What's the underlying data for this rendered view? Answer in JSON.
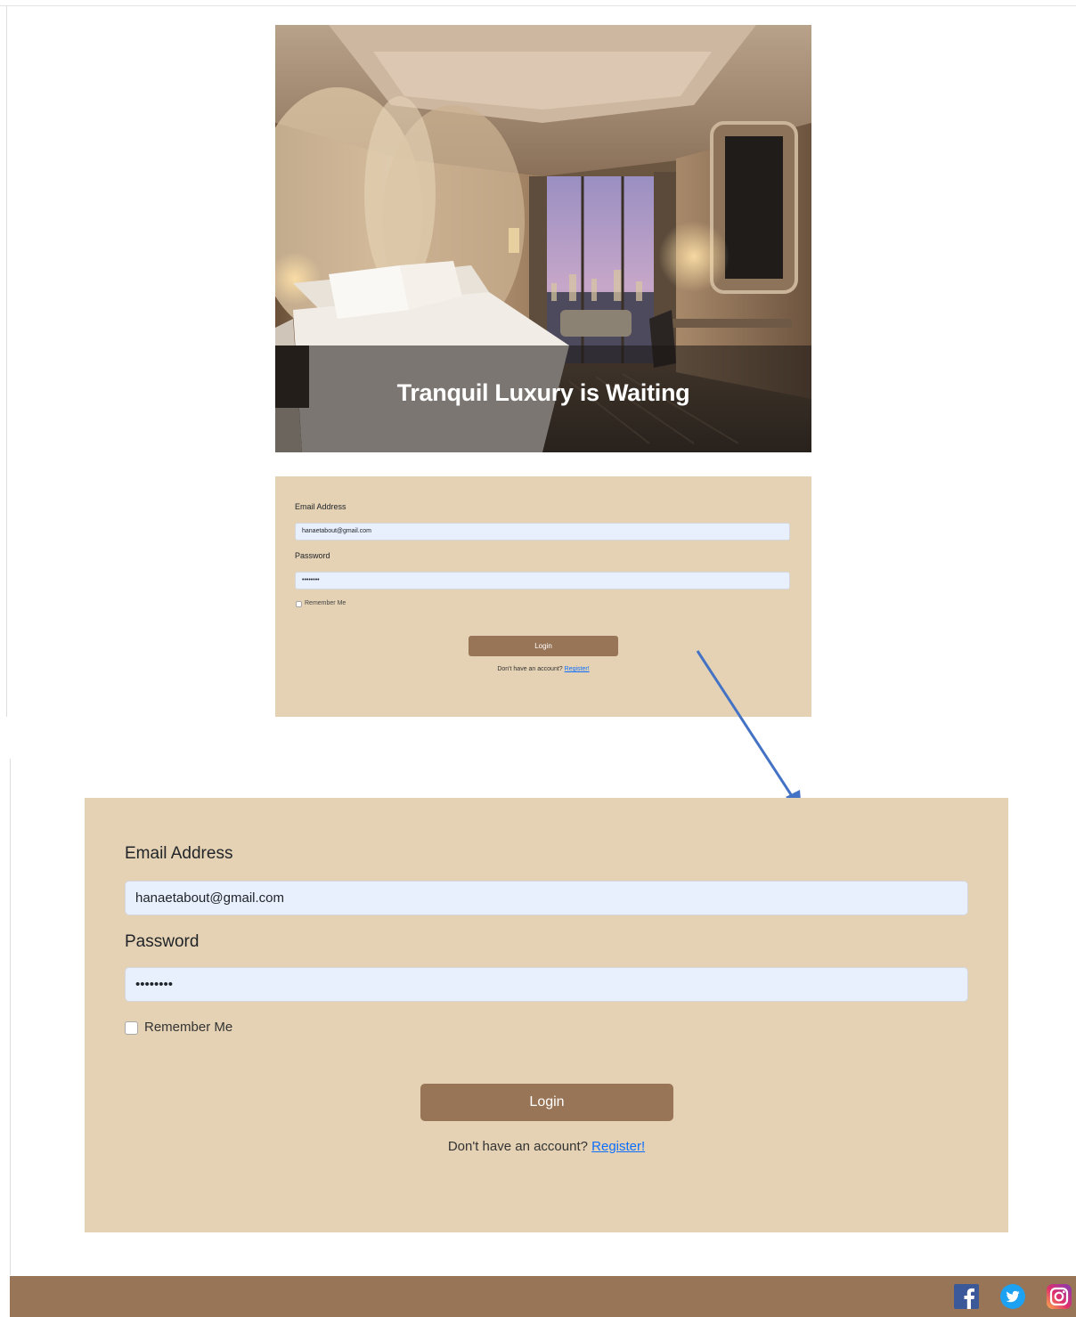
{
  "hero": {
    "title": "Tranquil Luxury is Waiting"
  },
  "login_small": {
    "email_label": "Email Address",
    "email_value": "hanaetabout@gmail.com",
    "password_label": "Password",
    "password_value": "••••••••",
    "remember_label": "Remember Me",
    "login_label": "Login",
    "register_prompt": "Don't have an account?",
    "register_link": "Register!"
  },
  "login_large": {
    "email_label": "Email Address",
    "email_value": "hanaetabout@gmail.com",
    "password_label": "Password",
    "password_value": "••••••••",
    "remember_label": "Remember Me",
    "login_label": "Login",
    "register_prompt": "Don't have an account?",
    "register_link": "Register!"
  },
  "footer": {
    "social_icons": [
      "facebook-icon",
      "twitter-icon",
      "instagram-icon"
    ]
  },
  "colors": {
    "card_background": "#e5d2b4",
    "accent_brown": "#987556",
    "input_background": "#e8f0fe",
    "link_blue": "#0d6efd",
    "arrow_blue": "#4472c4"
  }
}
